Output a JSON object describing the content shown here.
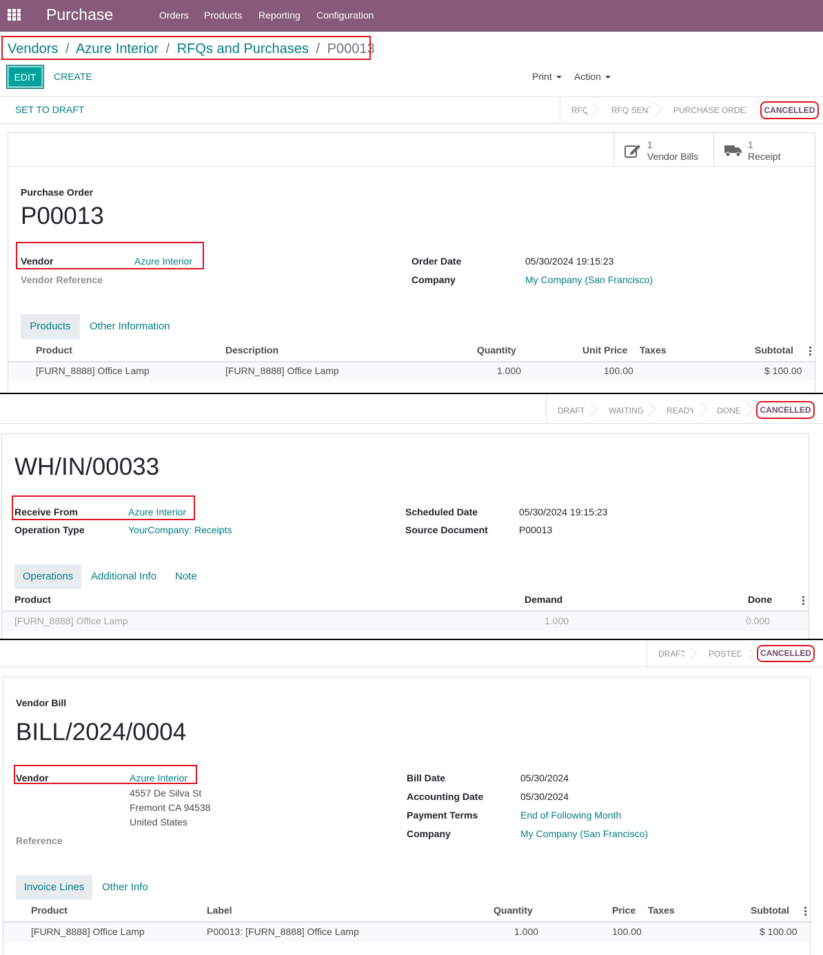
{
  "navbar": {
    "app_name": "Purchase",
    "menu": [
      "Orders",
      "Products",
      "Reporting",
      "Configuration"
    ]
  },
  "breadcrumb": {
    "items": [
      "Vendors",
      "Azure Interior",
      "RFQs and Purchases"
    ],
    "separator": "/",
    "current": "P00013"
  },
  "control": {
    "edit": "EDIT",
    "create": "CREATE",
    "print": "Print",
    "action": "Action"
  },
  "po": {
    "set_to_draft": "SET TO DRAFT",
    "stages": [
      "RFQ",
      "RFQ SENT",
      "PURCHASE ORDER"
    ],
    "current_stage": "CANCELLED",
    "smart_buttons": [
      {
        "count": "1",
        "label": "Vendor Bills",
        "icon": "pencil-square-icon"
      },
      {
        "count": "1",
        "label": "Receipt",
        "icon": "truck-icon"
      }
    ],
    "doc_label": "Purchase Order",
    "name": "P00013",
    "vendor_label": "Vendor",
    "vendor": "Azure Interior",
    "vendor_ref_label": "Vendor Reference",
    "order_date_label": "Order Date",
    "order_date": "05/30/2024 19:15:23",
    "company_label": "Company",
    "company": "My Company (San Francisco)",
    "tabs": [
      "Products",
      "Other Information"
    ],
    "columns": [
      "Product",
      "Description",
      "Quantity",
      "Unit Price",
      "Taxes",
      "Subtotal"
    ],
    "row": {
      "product": "[FURN_8888] Office Lamp",
      "description": "[FURN_8888] Office Lamp",
      "quantity": "1.000",
      "unit_price": "100.00",
      "taxes": "",
      "subtotal": "$ 100.00"
    }
  },
  "receipt": {
    "stages": [
      "DRAFT",
      "WAITING",
      "READY",
      "DONE"
    ],
    "current_stage": "CANCELLED",
    "name": "WH/IN/00033",
    "receive_from_label": "Receive From",
    "receive_from": "Azure Interior",
    "operation_type_label": "Operation Type",
    "operation_type": "YourCompany: Receipts",
    "scheduled_date_label": "Scheduled Date",
    "scheduled_date": "05/30/2024 19:15:23",
    "source_doc_label": "Source Document",
    "source_doc": "P00013",
    "tabs": [
      "Operations",
      "Additional Info",
      "Note"
    ],
    "columns": [
      "Product",
      "Demand",
      "Done"
    ],
    "row": {
      "product": "[FURN_8888] Office Lamp",
      "demand": "1.000",
      "done": "0.000"
    }
  },
  "bill": {
    "stages": [
      "DRAFT",
      "POSTED"
    ],
    "current_stage": "CANCELLED",
    "doc_label": "Vendor Bill",
    "name": "BILL/2024/0004",
    "vendor_label": "Vendor",
    "vendor": "Azure Interior",
    "address": [
      "4557 De Silva St",
      "Fremont CA 94538",
      "United States"
    ],
    "reference_label": "Reference",
    "bill_date_label": "Bill Date",
    "bill_date": "05/30/2024",
    "accounting_date_label": "Accounting Date",
    "accounting_date": "05/30/2024",
    "payment_terms_label": "Payment Terms",
    "payment_terms": "End of Following Month",
    "company_label": "Company",
    "company": "My Company (San Francisco)",
    "tabs": [
      "Invoice Lines",
      "Other Info"
    ],
    "columns": [
      "Product",
      "Label",
      "Quantity",
      "Price",
      "Taxes",
      "Subtotal"
    ],
    "row": {
      "product": "[FURN_8888] Office Lamp",
      "label": "P00013: [FURN_8888] Office Lamp",
      "quantity": "1.000",
      "price": "100.00",
      "taxes": "",
      "subtotal": "$ 100.00"
    }
  },
  "colors": {
    "navbar": "#875a7b",
    "link": "#017e84",
    "primary": "#00a09d",
    "highlight": "#e0141e"
  }
}
